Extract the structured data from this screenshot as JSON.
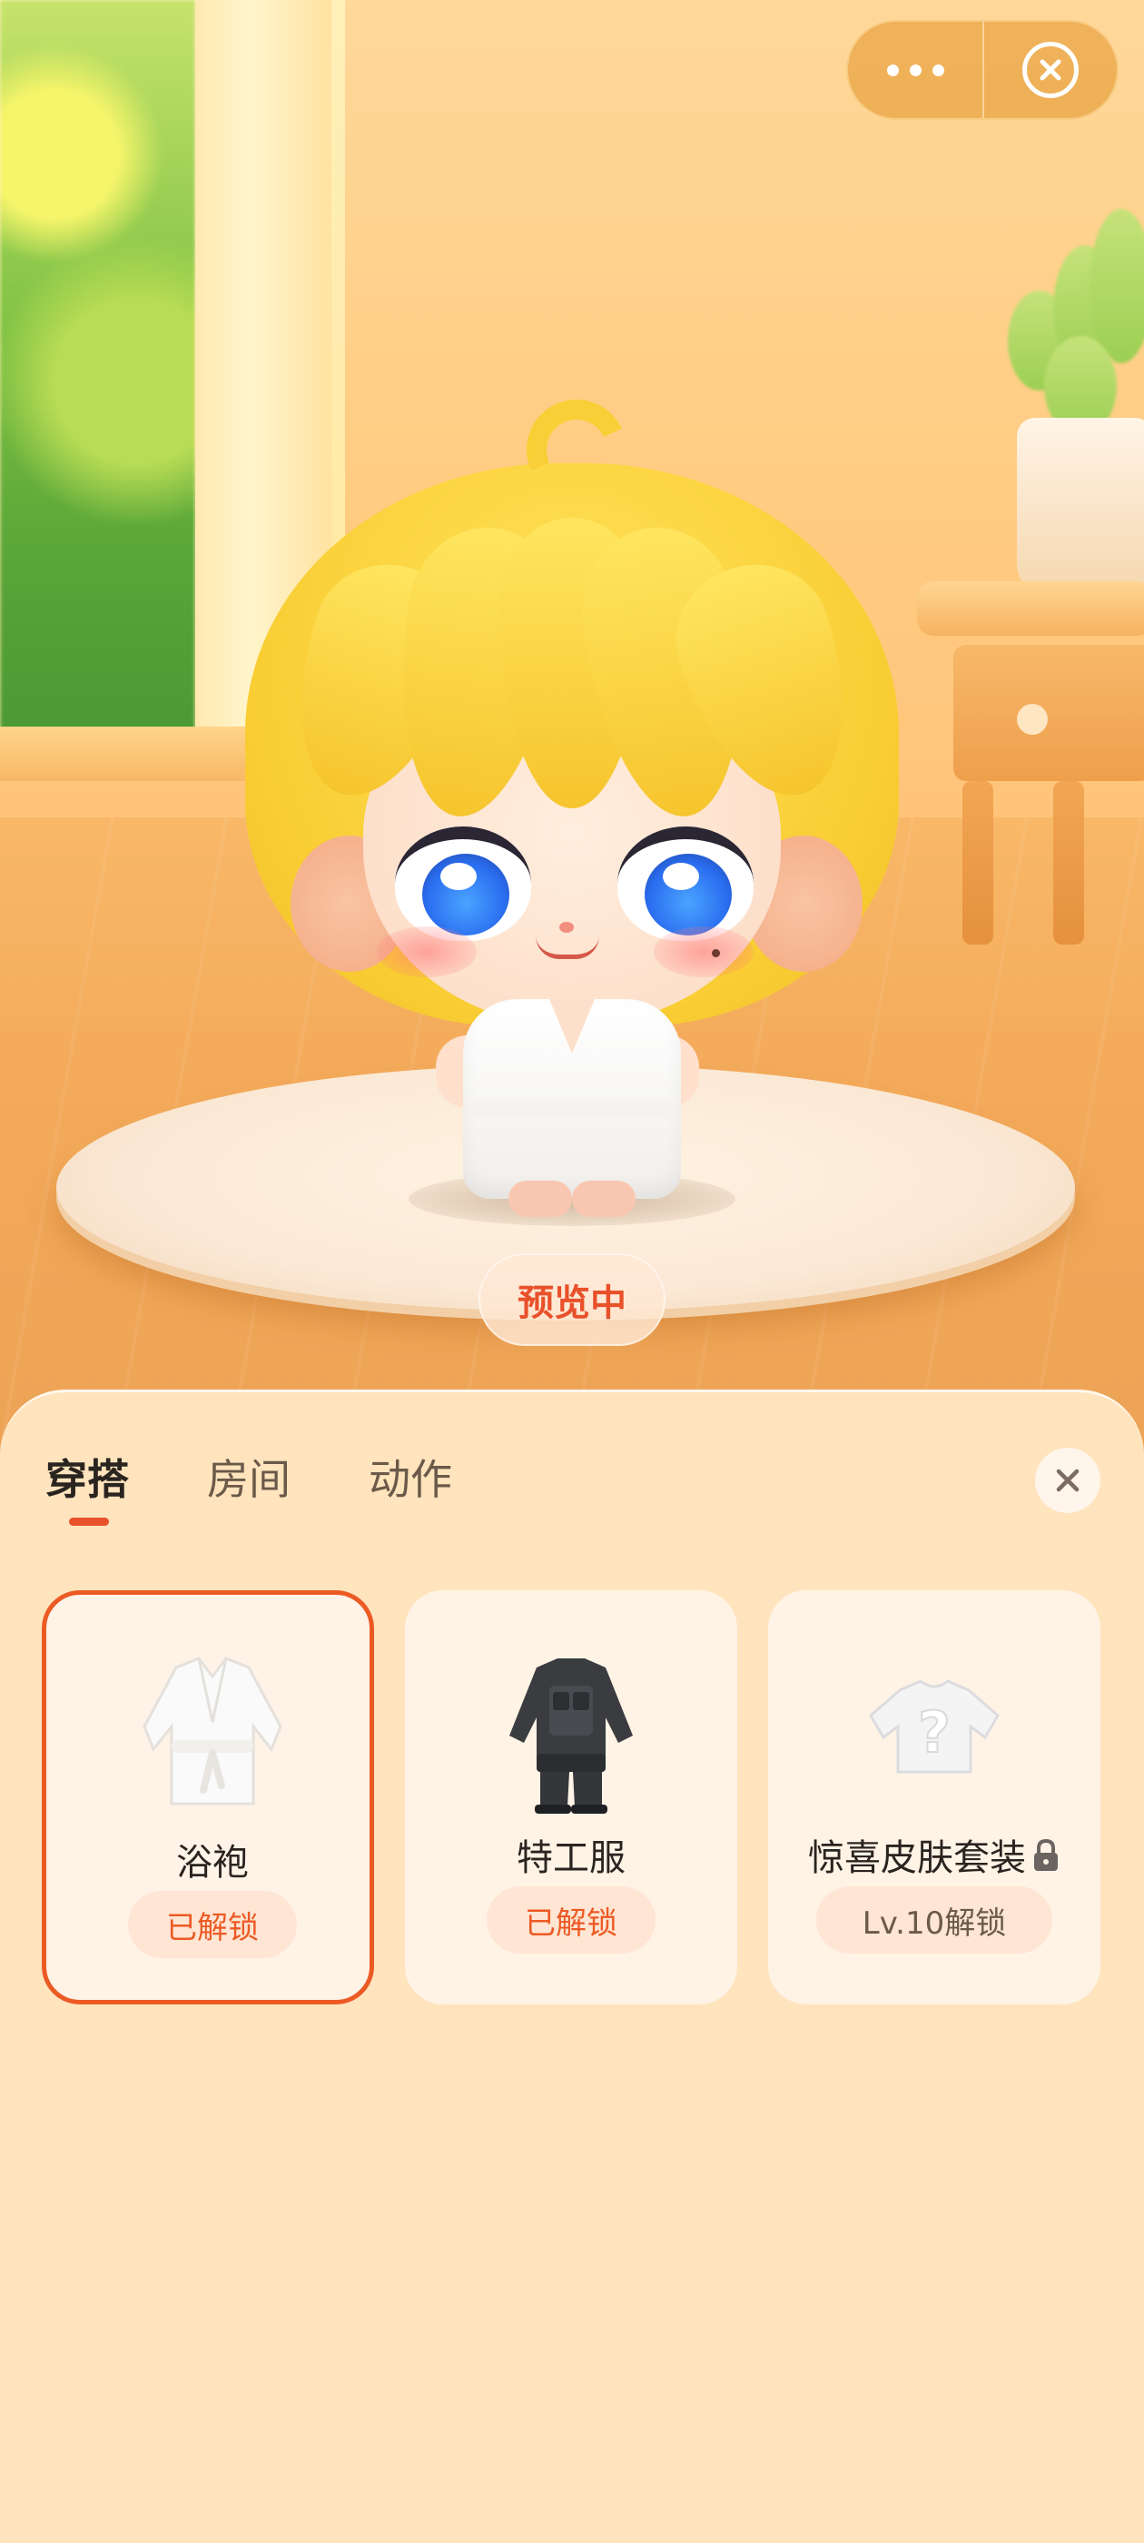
{
  "top_bar": {
    "more_icon": "more-dots-icon",
    "close_icon": "close-circle-icon"
  },
  "preview": {
    "label": "预览中"
  },
  "panel": {
    "tabs": [
      {
        "label": "穿搭",
        "active": true
      },
      {
        "label": "房间",
        "active": false
      },
      {
        "label": "动作",
        "active": false
      }
    ],
    "close_icon": "close-icon",
    "items": [
      {
        "name": "浴袍",
        "status": "已解锁",
        "selected": true,
        "icon": "bathrobe-icon"
      },
      {
        "name": "特工服",
        "status": "已解锁",
        "selected": false,
        "icon": "agent-suit-icon"
      },
      {
        "name": "惊喜皮肤套装",
        "status": "Lv.10解锁",
        "selected": false,
        "locked": true,
        "icon": "mystery-shirt-icon"
      }
    ]
  },
  "colors": {
    "accent": "#e8512a",
    "panel_bg": "#ffe4bd",
    "card_bg": "#fff3e6",
    "badge_bg": "#ffe5d4"
  }
}
